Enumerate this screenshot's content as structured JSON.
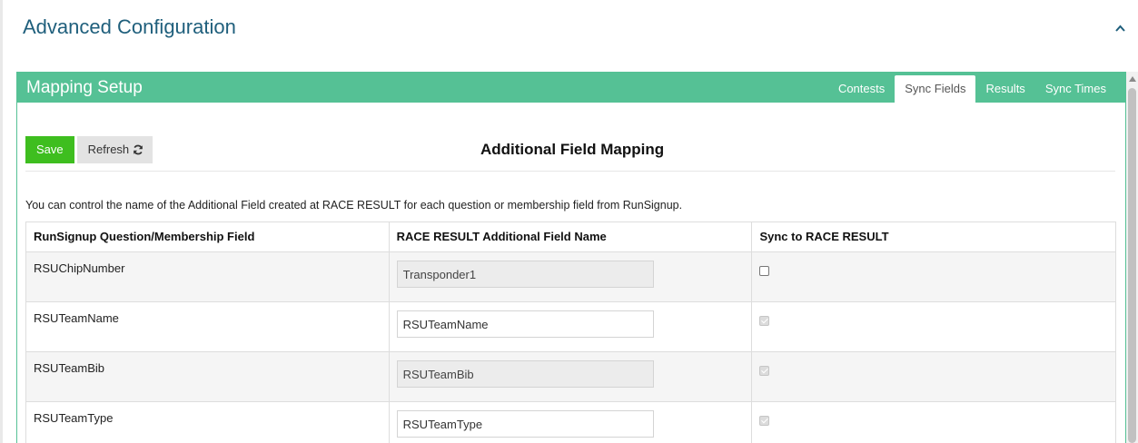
{
  "advanced": {
    "title": "Advanced Configuration",
    "collapse_icon": "chevron-up-icon"
  },
  "panel": {
    "title": "Mapping Setup",
    "tabs": [
      {
        "label": "Contests",
        "active": false
      },
      {
        "label": "Sync Fields",
        "active": true
      },
      {
        "label": "Results",
        "active": false
      },
      {
        "label": "Sync Times",
        "active": false
      }
    ]
  },
  "toolbar": {
    "save_label": "Save",
    "refresh_label": "Refresh",
    "refresh_icon": "refresh-icon"
  },
  "section_title": "Additional Field Mapping",
  "description": "You can control the name of the Additional Field created at RACE RESULT for each question or membership field from RunSignup.",
  "table": {
    "headers": [
      "RunSignup Question/Membership Field",
      "RACE RESULT Additional Field Name",
      "Sync to RACE RESULT"
    ],
    "rows": [
      {
        "field": "RSUChipNumber",
        "name": "Transponder1",
        "input_disabled": true,
        "sync_checked": false,
        "sync_disabled": false
      },
      {
        "field": "RSUTeamName",
        "name": "RSUTeamName",
        "input_disabled": false,
        "sync_checked": true,
        "sync_disabled": true
      },
      {
        "field": "RSUTeamBib",
        "name": "RSUTeamBib",
        "input_disabled": true,
        "sync_checked": true,
        "sync_disabled": true
      },
      {
        "field": "RSUTeamType",
        "name": "RSUTeamType",
        "input_disabled": false,
        "sync_checked": true,
        "sync_disabled": true
      }
    ]
  },
  "colors": {
    "accent_green": "#55c195",
    "save_green": "#3ebe1f",
    "title_blue": "#1f5f7c"
  }
}
